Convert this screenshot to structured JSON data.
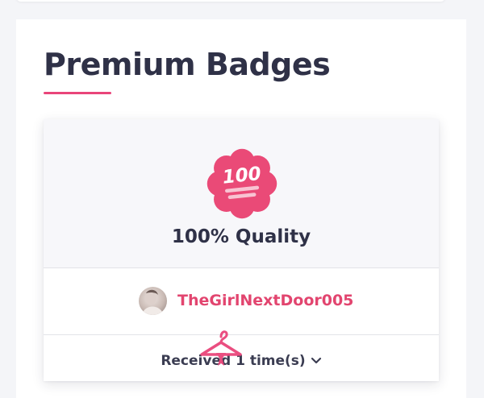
{
  "section": {
    "title": "Premium Badges"
  },
  "badge": {
    "icon": "hundred-points-icon",
    "icon_text": "100",
    "name": "100% Quality",
    "accent_color": "#e9457a"
  },
  "creator": {
    "username": "TheGirlNextDoor005",
    "avatar": "creator-avatar"
  },
  "received": {
    "label": "Received 1 time(s)",
    "icon": "chevron-down-icon"
  },
  "watermark": {
    "icon": "hanger-icon"
  }
}
